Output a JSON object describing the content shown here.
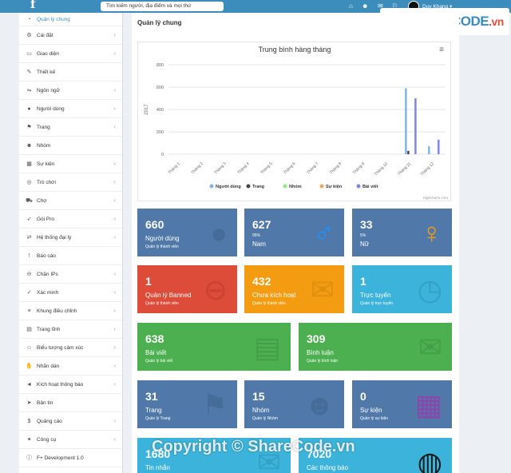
{
  "topbar": {
    "search_placeholder": "Tìm kiếm người, địa điểm và mọi thứ",
    "username": "Duy Khang"
  },
  "watermark": {
    "brand_name": "SHARECODE",
    "brand_domain": ".vn",
    "copyright_text": "Copyright © ShareCode.vn"
  },
  "sidebar": {
    "items": [
      {
        "label": "Quản lý chung",
        "icon": "dashboard-icon",
        "arrow": false
      },
      {
        "label": "Cài đặt",
        "icon": "gear-icon",
        "arrow": true
      },
      {
        "label": "Giao diện",
        "icon": "monitor-icon",
        "arrow": true
      },
      {
        "label": "Thiết kế",
        "icon": "brush-icon",
        "arrow": false
      },
      {
        "label": "Ngôn ngữ",
        "icon": "language-icon",
        "arrow": true
      },
      {
        "label": "Người dùng",
        "icon": "user-icon",
        "arrow": true
      },
      {
        "label": "Trang",
        "icon": "flag-icon",
        "arrow": true
      },
      {
        "label": "Nhóm",
        "icon": "users-icon",
        "arrow": false
      },
      {
        "label": "Sự kiện",
        "icon": "calendar-icon",
        "arrow": true
      },
      {
        "label": "Trò chơi",
        "icon": "gamepad-icon",
        "arrow": true
      },
      {
        "label": "Chợ",
        "icon": "cart-icon",
        "arrow": true
      },
      {
        "label": "Gói Pro",
        "icon": "rocket-icon",
        "arrow": true
      },
      {
        "label": "Hệ thống đại lý",
        "icon": "exchange-icon",
        "arrow": true
      },
      {
        "label": "Báo cáo",
        "icon": "alert-icon",
        "arrow": false
      },
      {
        "label": "Chặn IPs",
        "icon": "block-icon",
        "arrow": true
      },
      {
        "label": "Xác minh",
        "icon": "check-icon",
        "arrow": true
      },
      {
        "label": "Khung điều chỉnh",
        "icon": "bars-icon",
        "arrow": true
      },
      {
        "label": "Trang tĩnh",
        "icon": "file-icon",
        "arrow": true
      },
      {
        "label": "Biểu tượng cảm xúc",
        "icon": "smile-icon",
        "arrow": true
      },
      {
        "label": "Nhãn dán",
        "icon": "hand-icon",
        "arrow": true
      },
      {
        "label": "Kích hoạt thông báo",
        "icon": "bullhorn-icon",
        "arrow": true
      },
      {
        "label": "Bản tin",
        "icon": "send-icon",
        "arrow": false
      },
      {
        "label": "Quảng cáo",
        "icon": "dollar-icon",
        "arrow": true
      },
      {
        "label": "Công cụ",
        "icon": "wrench-icon",
        "arrow": true
      },
      {
        "label": "F+ Development 1.0",
        "icon": "info-icon",
        "arrow": false
      }
    ]
  },
  "main": {
    "page_title": "Quản lý chung"
  },
  "chart_data": {
    "type": "bar",
    "title": "Trung bình hàng tháng",
    "ylabel": "2017",
    "credits": "Highcharts.com",
    "ylim": [
      0,
      800
    ],
    "yticks": [
      0,
      200,
      400,
      600,
      800
    ],
    "categories": [
      "Tháng 1",
      "Tháng 2",
      "Tháng 3",
      "Tháng 4",
      "Tháng 5",
      "Tháng 6",
      "Tháng 7",
      "Tháng 8",
      "Tháng 9",
      "Tháng 10",
      "Tháng 11",
      "Tháng 12"
    ],
    "series": [
      {
        "name": "Người dùng",
        "color": "#7cb5ec",
        "values": [
          0,
          0,
          0,
          0,
          0,
          0,
          0,
          0,
          0,
          0,
          590,
          70
        ]
      },
      {
        "name": "Trang",
        "color": "#434348",
        "values": [
          0,
          0,
          0,
          0,
          0,
          0,
          0,
          0,
          0,
          0,
          30,
          0
        ]
      },
      {
        "name": "Nhóm",
        "color": "#90ed7d",
        "values": [
          0,
          0,
          0,
          0,
          0,
          0,
          0,
          0,
          0,
          0,
          0,
          0
        ]
      },
      {
        "name": "Sự kiện",
        "color": "#f7a35c",
        "values": [
          0,
          0,
          0,
          0,
          0,
          0,
          0,
          0,
          0,
          0,
          0,
          0
        ]
      },
      {
        "name": "Bài viết",
        "color": "#8085e9",
        "values": [
          0,
          0,
          0,
          0,
          0,
          0,
          0,
          0,
          0,
          0,
          500,
          130
        ]
      }
    ],
    "legend": "bottom",
    "grid": true
  },
  "cards": [
    {
      "num": "660",
      "label": "Người dùng",
      "sub": "Quản lý thành viên",
      "color": "#5079a9",
      "icon": "user-icon",
      "icon_color": "#3a5f8a"
    },
    {
      "num": "627",
      "pct": "95%",
      "label": "Nam",
      "color": "#5079a9",
      "icon": "male-icon",
      "icon_color": "#1e90ff"
    },
    {
      "num": "33",
      "pct": "5%",
      "label": "Nữ",
      "color": "#5079a9",
      "icon": "female-icon",
      "icon_color": "#f39c12"
    },
    {
      "num": "1",
      "label": "Quản lý Banned",
      "sub": "Quản lý thành viên",
      "color": "#dd4b39",
      "icon": "minus-circle-icon",
      "icon_color": "#b33a2b"
    },
    {
      "num": "432",
      "label": "Chưa kích hoạt",
      "sub": "Quản lý thành viên",
      "color": "#f39c12",
      "icon": "envelope-icon",
      "icon_color": "#c77e0e"
    },
    {
      "num": "1",
      "label": "Trực tuyến",
      "sub": "Quản lý trực tuyến",
      "color": "#3cb3da",
      "icon": "clock-icon",
      "icon_color": "#2a8cb0"
    },
    {
      "num": "638",
      "label": "Bài viết",
      "sub": "Quản lý bài viết",
      "color": "#4caf50",
      "icon": "newspaper-icon",
      "icon_color": "#3a8c3e"
    },
    {
      "num": "309",
      "label": "Bình luận",
      "sub": "Quản lý bình luận",
      "color": "#4caf50",
      "icon": "comments-icon",
      "icon_color": "#3a8c3e"
    },
    {
      "num": "31",
      "label": "Trang",
      "sub": "Quản lý Trang",
      "color": "#5079a9",
      "icon": "flag-icon",
      "icon_color": "#3a5f8a"
    },
    {
      "num": "15",
      "label": "Nhóm",
      "sub": "Quản lý Nhóm",
      "color": "#5079a9",
      "icon": "users-icon",
      "icon_color": "#3a5f8a"
    },
    {
      "num": "0",
      "label": "Sự kiện",
      "sub": "Quản lý sự kiện",
      "color": "#5079a9",
      "icon": "calendar-icon",
      "icon_color": "#8e44ad"
    },
    {
      "num": "1680",
      "label": "Tin nhắn",
      "sub": "",
      "color": "#3cb3da",
      "icon": "envelope-icon",
      "icon_color": "#2a8cb0"
    },
    {
      "num": "7020",
      "label": "Các thông báo",
      "sub": "",
      "color": "#3cb3da",
      "icon": "globe-icon",
      "icon_color": "#1a1a1a"
    }
  ]
}
